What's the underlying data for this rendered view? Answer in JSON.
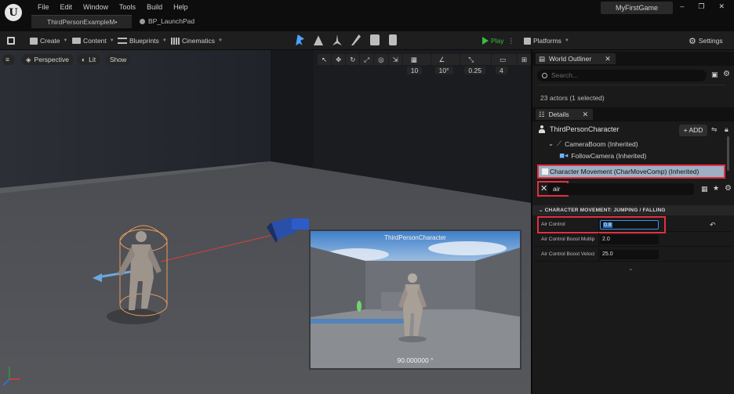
{
  "menu": [
    "File",
    "Edit",
    "Window",
    "Tools",
    "Build",
    "Help"
  ],
  "tabs": [
    {
      "label": "ThirdPersonExampleM•",
      "active": true
    },
    {
      "label": "BP_LaunchPad",
      "active": false
    }
  ],
  "project_name": "MyFirstGame",
  "window_controls": [
    "–",
    "❐",
    "✕"
  ],
  "toolbar": {
    "create": "Create",
    "content": "Content",
    "blueprints": "Blueprints",
    "cinematics": "Cinematics",
    "play": "Play",
    "platforms": "Platforms",
    "settings": "Settings"
  },
  "viewport": {
    "perspective": "Perspective",
    "lit": "Lit",
    "show": "Show",
    "grid_snap": "10",
    "rotation_snap": "10°",
    "scale_snap": "0.25",
    "camera_speed": "4"
  },
  "camera_preview": {
    "title": "ThirdPersonCharacter",
    "fov": "90.000000 °"
  },
  "outliner": {
    "title": "World Outliner",
    "search_placeholder": "Search...",
    "actor_count": "23 actors (1 selected)"
  },
  "details": {
    "title": "Details",
    "actor": "ThirdPersonCharacter",
    "add_label": "+ ADD",
    "components": [
      {
        "label": "CameraBoom (Inherited)"
      },
      {
        "label": "FollowCamera (Inherited)"
      }
    ],
    "selected_component": "Character Movement (CharMoveComp) (Inherited)",
    "filter_value": "air",
    "category": "CHARACTER MOVEMENT: JUMPING / FALLING",
    "properties": [
      {
        "label": "Air Control",
        "value": "0.8"
      },
      {
        "label": "Air Control Boost Multipli",
        "value": "2.0"
      },
      {
        "label": "Air Control Boost Velocit",
        "value": "25.0"
      }
    ]
  },
  "colors": {
    "highlight_red": "#e03040",
    "selection_blue": "#9fb0c4",
    "play_green": "#3bbd3b"
  }
}
